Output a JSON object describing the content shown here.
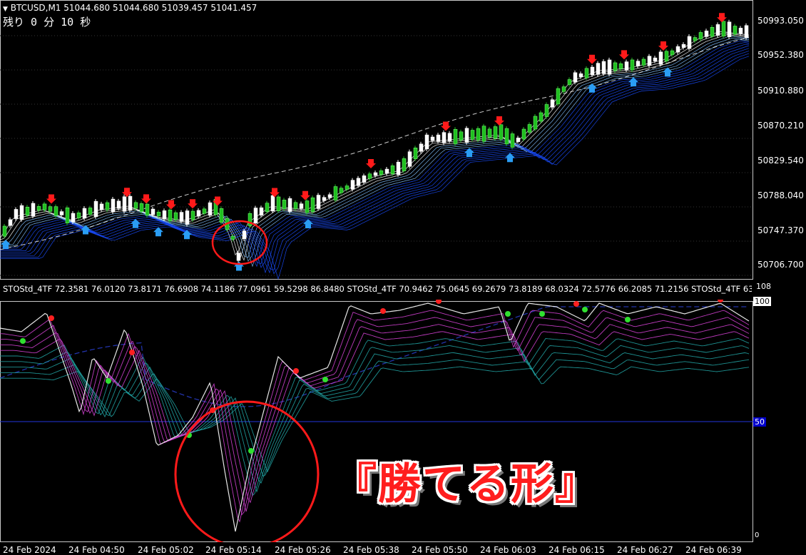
{
  "header": {
    "symbol_line": "BTCUSD,M1  51044.680 51044.680 51039.457 51041.457",
    "countdown": "残り 0 分 10 秒"
  },
  "price_axis": [
    "50993.050",
    "50952.380",
    "50910.880",
    "50870.210",
    "50829.540",
    "50788.040",
    "50747.370",
    "50706.700"
  ],
  "indicator": {
    "header": "STOStd_4TF 72.3581 76.0120 73.8171 76.6908 74.1186 77.0961 59.5298 86.8480   STOStd_4TF 70.9462 75.0645 69.2679 73.8189 68.0324 72.5776 66.2085 71.2156   STOStd_4TF 63",
    "level_top": "108",
    "level_100": "100",
    "level_50": "50",
    "level_0": "0"
  },
  "time_axis": [
    "24 Feb 2024",
    "24 Feb 04:50",
    "24 Feb 05:02",
    "24 Feb 05:14",
    "24 Feb 05:26",
    "24 Feb 05:38",
    "24 Feb 05:50",
    "24 Feb 06:03",
    "24 Feb 06:15",
    "24 Feb 06:27",
    "24 Feb 06:39"
  ],
  "annotation": {
    "text": "『勝てる形』"
  },
  "colors": {
    "bull": "#1fbf1f",
    "bear": "#ffffff",
    "down_arrow": "#ff1a1a",
    "up_arrow": "#2a9df4",
    "ribbon": "#2a6bff",
    "annotation": "#ff1e1e"
  }
}
